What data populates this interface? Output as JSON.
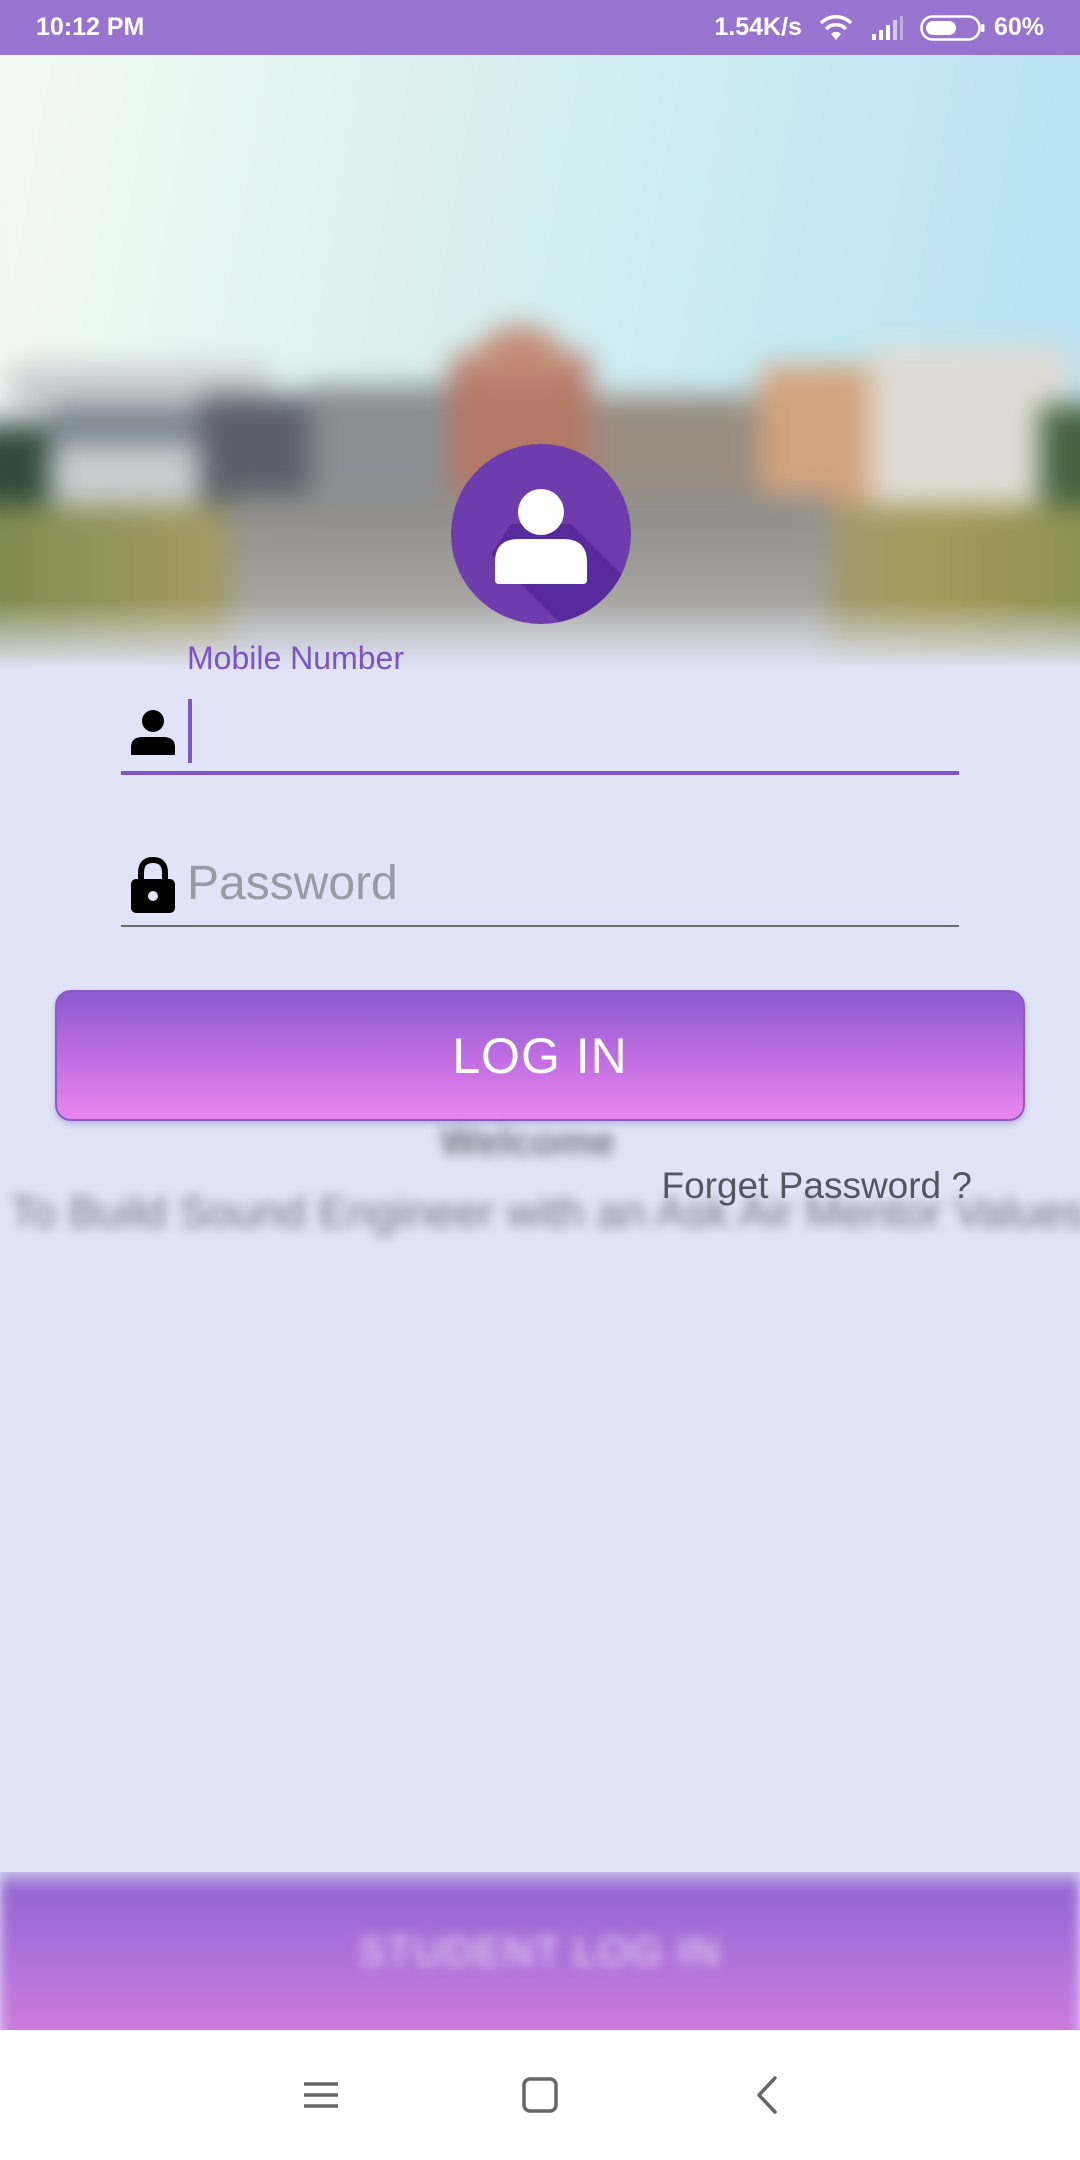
{
  "status_bar": {
    "time": "10:12 PM",
    "network_speed": "1.54K/s",
    "battery": "60%",
    "battery_level": 0.6,
    "icons": [
      "wifi-icon",
      "signal-icon",
      "battery-icon"
    ]
  },
  "hero": {
    "description_icon": "user-avatar-icon"
  },
  "form": {
    "mobile_label": "Mobile Number",
    "mobile_value": "",
    "mobile_icon": "person-icon",
    "password_placeholder": "Password",
    "password_value": "",
    "password_icon": "lock-icon",
    "login_label": "LOG IN",
    "forgot_label": "Forget Password ?"
  },
  "background_blurred": {
    "line1": "Welcome",
    "line2": "To Build Sound Engineer with an Ask Air Mentor Values",
    "bottom_bar": "STUDENT LOG IN"
  },
  "colors": {
    "accent": "#7e57c2",
    "status_bar": "#9874d0",
    "button_top": "#8d5bd0",
    "button_bottom": "#ea85ee",
    "background": "#e0e4f6"
  },
  "nav": {
    "icons": [
      "menu-icon",
      "home-icon",
      "back-icon"
    ]
  }
}
